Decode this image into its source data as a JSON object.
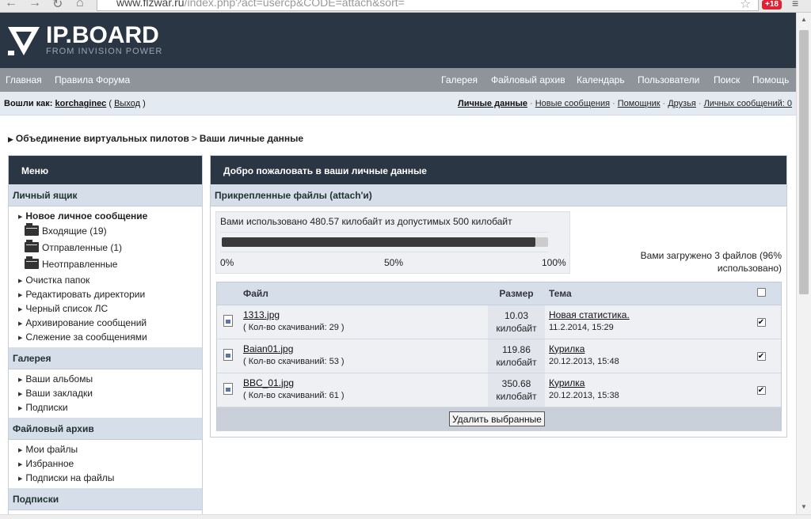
{
  "browser": {
    "url_host": "www.flzwar.ru",
    "url_rest": "/index.php?act=usercp&CODE=attach&sort=",
    "badge": "+18"
  },
  "header": {
    "logo": "IP.BOARD",
    "logo_sub": "FROM INVISION POWER"
  },
  "nav": {
    "left": [
      "Главная",
      "Правила Форума"
    ],
    "right": [
      "Галерея",
      "Файловый архив",
      "Календарь",
      "Пользователи",
      "Поиск",
      "Помощь"
    ]
  },
  "userbar": {
    "logged_in_label": "Вошли как:",
    "username": "korchaginec",
    "logout": "Выход",
    "links": [
      "Личные данные",
      "Новые сообщения",
      "Помощник",
      "Друзья",
      "Личных сообщений: 0"
    ]
  },
  "breadcrumb": {
    "forum": "Объединение виртуальных пилотов",
    "page": "Ваши личные данные"
  },
  "sidebar": {
    "title": "Меню",
    "sections": [
      {
        "title": "Личный ящик",
        "items": [
          {
            "label": "Новое личное сообщение",
            "kind": "bold"
          },
          {
            "label": "Входящие (19)",
            "kind": "folder"
          },
          {
            "label": "Отправленные (1)",
            "kind": "folder"
          },
          {
            "label": "Неотправленные",
            "kind": "folder"
          },
          {
            "label": "Очистка папок",
            "kind": "bullet"
          },
          {
            "label": "Редактировать директории",
            "kind": "bullet"
          },
          {
            "label": "Черный список ЛС",
            "kind": "bullet"
          },
          {
            "label": "Архивирование сообщений",
            "kind": "bullet"
          },
          {
            "label": "Слежение за сообщениями",
            "kind": "bullet"
          }
        ]
      },
      {
        "title": "Галерея",
        "items": [
          {
            "label": "Ваши альбомы",
            "kind": "bullet"
          },
          {
            "label": "Ваши закладки",
            "kind": "bullet"
          },
          {
            "label": "Подписки",
            "kind": "bullet"
          }
        ]
      },
      {
        "title": "Файловый архив",
        "items": [
          {
            "label": "Мои файлы",
            "kind": "bullet"
          },
          {
            "label": "Избранное",
            "kind": "bullet"
          },
          {
            "label": "Подписки на файлы",
            "kind": "bullet"
          }
        ]
      },
      {
        "title": "Подписки",
        "items": []
      }
    ]
  },
  "main": {
    "title": "Добро пожаловать в ваши личные данные",
    "subtitle": "Прикрепленные файлы (attach'и)",
    "quota_text": "Вами использовано 480.57 килобайт из допустимых 500 килобайт",
    "quota_fraction": 0.961,
    "ticks": [
      "0%",
      "50%",
      "100%"
    ],
    "uploaded_text": "Вами загружено 3 файлов (96% использовано)",
    "columns": {
      "file": "Файл",
      "size": "Размер",
      "topic": "Тема"
    },
    "files": [
      {
        "name": "1313.jpg",
        "downloads": "( Кол-во скачиваний: 29 )",
        "size_value": "10.03",
        "size_unit": "килобайт",
        "topic": "Новая статистика.",
        "date": "11.2.2014, 15:29",
        "checked": true
      },
      {
        "name": "Baian01.jpg",
        "downloads": "( Кол-во скачиваний: 53 )",
        "size_value": "119.86",
        "size_unit": "килобайт",
        "topic": "Курилка",
        "date": "20.12.2013, 15:48",
        "checked": true
      },
      {
        "name": "BBC_01.jpg",
        "downloads": "( Кол-во скачиваний: 61 )",
        "size_value": "350.68",
        "size_unit": "килобайт",
        "topic": "Курилка",
        "date": "20.12.2013, 15:38",
        "checked": true
      }
    ],
    "delete_button": "Удалить выбранные"
  }
}
